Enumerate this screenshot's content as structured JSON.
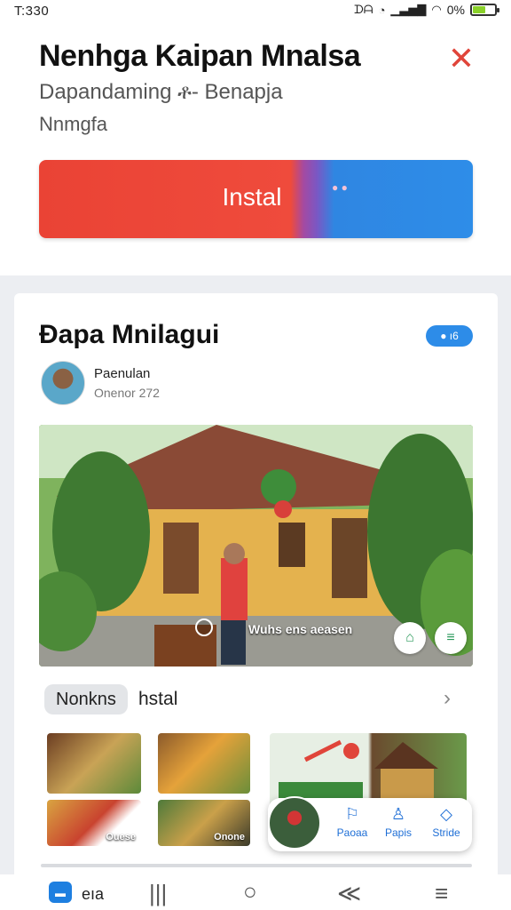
{
  "status_bar": {
    "time": "T:330",
    "left_icons": "ᗪᗩ",
    "battery_text": "0%",
    "battery_level": 0.6
  },
  "app": {
    "title": "Nenhga Kaipan Mnalsa",
    "subtitle": "Dapandaming  ቶ- Benapja",
    "subtitle2": "Nnmgfa",
    "install_label": "Instal",
    "close_icon": "close-icon",
    "accent_red": "#ea4335",
    "accent_blue": "#2e8de8"
  },
  "card": {
    "title": "Ðapa Mnilagui",
    "badge": "● ı6",
    "author_name": "Paenulan",
    "author_meta": "Onenor 272",
    "photo_caption": "Wuhs ens aeasen",
    "chip_label": "Nonkns",
    "chip_text": "hstal",
    "thumbs": [
      {
        "caption": ""
      },
      {
        "caption": ""
      },
      {
        "caption": "Ouese"
      },
      {
        "caption": "Onone"
      }
    ]
  },
  "float_menu": [
    {
      "label": "Paoaa",
      "icon": "flag-icon"
    },
    {
      "label": "Papis",
      "icon": "person-icon"
    },
    {
      "label": "Stride",
      "icon": "tag-icon"
    }
  ],
  "nav": {
    "home_label": "eıa"
  }
}
